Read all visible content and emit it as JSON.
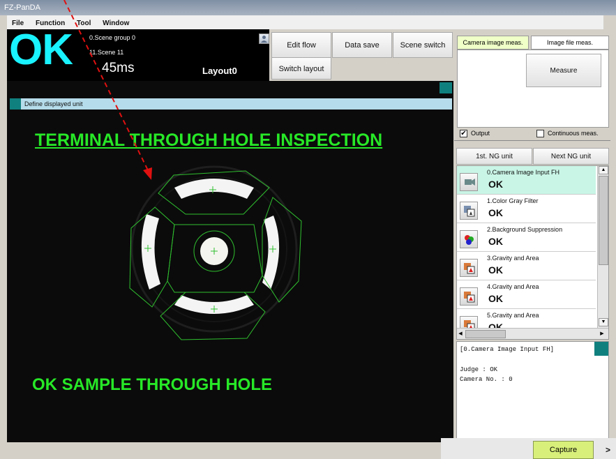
{
  "window": {
    "title": "FZ-PanDA"
  },
  "menu": {
    "file": "File",
    "function": "Function",
    "tool": "Tool",
    "window": "Window"
  },
  "status": {
    "judge": "OK",
    "scene_group": "0.Scene group 0",
    "scene": "11.Scene 11",
    "time": "45ms",
    "layout": "Layout0"
  },
  "toolbar": {
    "edit_flow": "Edit flow",
    "data_save": "Data save",
    "scene_switch": "Scene switch",
    "switch_layout": "Switch layout"
  },
  "image_window": {
    "header": "Define displayed unit",
    "title_overlay": "TERMINAL THROUGH HOLE INSPECTION",
    "bottom_overlay": "OK SAMPLE THROUGH HOLE"
  },
  "measure_panel": {
    "tab_camera": "Camera image meas.",
    "tab_file": "Image file meas.",
    "measure_button": "Measure",
    "output_label": "Output",
    "continuous_label": "Continuous meas.",
    "output_checked": true,
    "continuous_checked": false
  },
  "ng_buttons": {
    "first": "1st. NG unit",
    "next": "Next NG unit"
  },
  "flow_units": [
    {
      "name": "0.Camera Image Input FH",
      "judge": "OK",
      "icon": "camera-icon",
      "selected": true
    },
    {
      "name": "1.Color Gray Filter",
      "judge": "OK",
      "icon": "filter-icon",
      "selected": false
    },
    {
      "name": "2.Background Suppression",
      "judge": "OK",
      "icon": "background-suppression-icon",
      "selected": false
    },
    {
      "name": "3.Gravity and Area",
      "judge": "OK",
      "icon": "gravity-area-icon",
      "selected": false
    },
    {
      "name": "4.Gravity and Area",
      "judge": "OK",
      "icon": "gravity-area-icon",
      "selected": false
    },
    {
      "name": "5.Gravity and Area",
      "judge": "OK",
      "icon": "gravity-area-icon",
      "selected": false
    }
  ],
  "detail": {
    "line1": "[0.Camera Image Input FH]",
    "line2": "Judge : OK",
    "line3": "Camera No. : 0"
  },
  "footer": {
    "capture": "Capture",
    "more": ">"
  },
  "colors": {
    "judge_ok": "#19f2ff",
    "overlay_green": "#27e827",
    "selected_row": "#c9f5e6",
    "capture_bg": "#d8f07a"
  }
}
